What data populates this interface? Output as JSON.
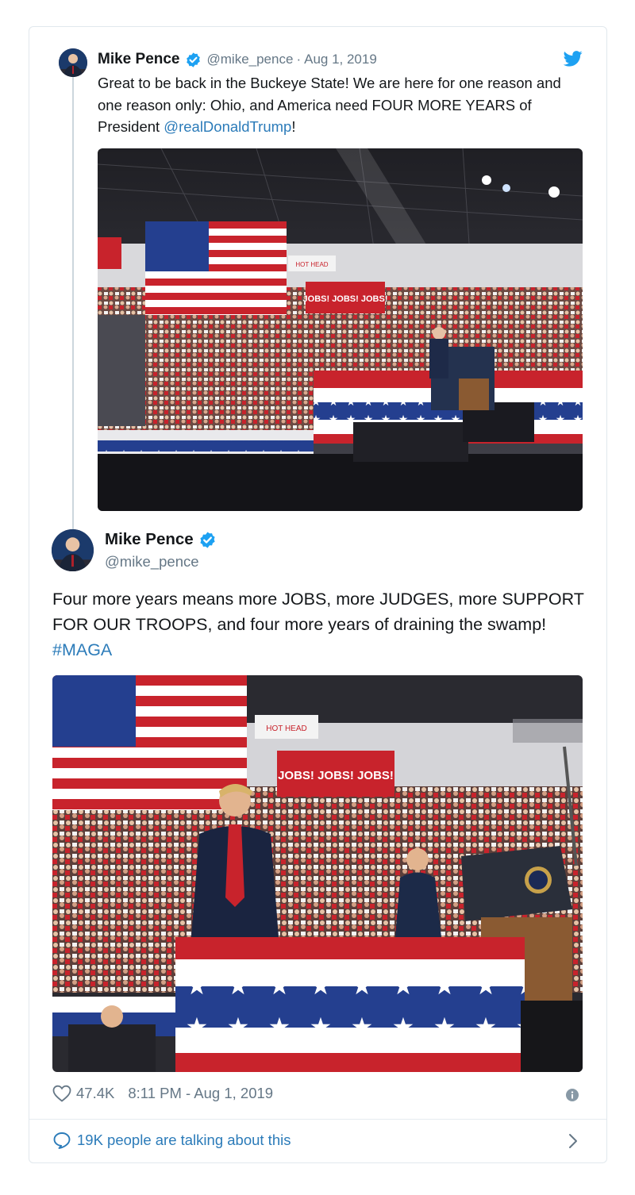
{
  "parent_tweet": {
    "author_name": "Mike Pence",
    "handle": "@mike_pence",
    "separator": "·",
    "date": "Aug 1, 2019",
    "text_before_mention": "Great to be back in the Buckeye State! We are here for one reason and one reason only: Ohio, and America need FOUR MORE YEARS of President ",
    "mention": "@realDonaldTrump",
    "text_after_mention": "!",
    "photo_signs": [
      "JOBS! JOBS! JOBS!",
      "HOT HEAD"
    ]
  },
  "main_tweet": {
    "author_name": "Mike Pence",
    "handle": "@mike_pence",
    "text": "Four more years means more JOBS, more JUDGES, more SUPPORT FOR OUR TROOPS, and four more years of draining the swamp! ",
    "hashtag": "#MAGA",
    "photo_signs": [
      "JOBS! JOBS! JOBS!",
      "HOT HEAD"
    ],
    "likes": "47.4K",
    "timestamp": "8:11 PM - Aug 1, 2019",
    "talking": "19K people are talking about this"
  },
  "icons": {
    "verified": "verified-badge-icon",
    "bird": "twitter-bird-icon",
    "heart": "heart-icon",
    "info": "info-icon",
    "bubble": "speech-bubble-icon",
    "chevron": "chevron-right-icon"
  },
  "colors": {
    "link": "#2b7bb9",
    "verified": "#1da1f2",
    "muted": "#657786",
    "text": "#14171a"
  }
}
